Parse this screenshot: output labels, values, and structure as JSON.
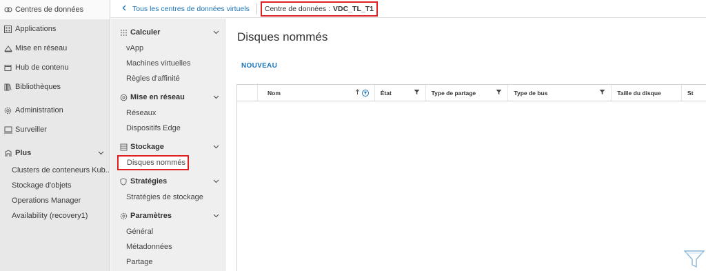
{
  "leftnav": {
    "items": [
      {
        "label": "Centres de données",
        "icon": "datacenter-icon"
      },
      {
        "label": "Applications",
        "icon": "applications-icon"
      },
      {
        "label": "Mise en réseau",
        "icon": "network-icon"
      },
      {
        "label": "Hub de contenu",
        "icon": "content-hub-icon"
      },
      {
        "label": "Bibliothèques",
        "icon": "library-icon"
      },
      {
        "label": "Administration",
        "icon": "gear-icon"
      },
      {
        "label": "Surveiller",
        "icon": "monitor-icon"
      }
    ],
    "plus": {
      "label": "Plus",
      "icon": "plus-group-icon"
    },
    "plus_items": [
      "Clusters de conteneurs Kub...",
      "Stockage d'objets",
      "Operations Manager",
      "Availability (recovery1)"
    ]
  },
  "topbar": {
    "back_label": "Tous les centres de données virtuels",
    "dc_prefix": "Centre de données :",
    "dc_name": "VDC_TL_T1"
  },
  "secnav": {
    "calculer": {
      "title": "Calculer",
      "items": [
        "vApp",
        "Machines virtuelles",
        "Règles d'affinité"
      ]
    },
    "reseau": {
      "title": "Mise en réseau",
      "items": [
        "Réseaux",
        "Dispositifs Edge"
      ]
    },
    "stockage": {
      "title": "Stockage",
      "items": [
        "Disques nommés"
      ]
    },
    "strategies": {
      "title": "Stratégies",
      "items": [
        "Stratégies de stockage"
      ]
    },
    "parametres": {
      "title": "Paramètres",
      "items": [
        "Général",
        "Métadonnées",
        "Partage"
      ]
    }
  },
  "main": {
    "title": "Disques nommés",
    "new_button": "NOUVEAU",
    "columns": [
      "Nom",
      "État",
      "Type de partage",
      "Type de bus",
      "Taille du disque",
      "St"
    ]
  },
  "colors": {
    "accent": "#1a73b8",
    "highlight": "#e02020"
  }
}
